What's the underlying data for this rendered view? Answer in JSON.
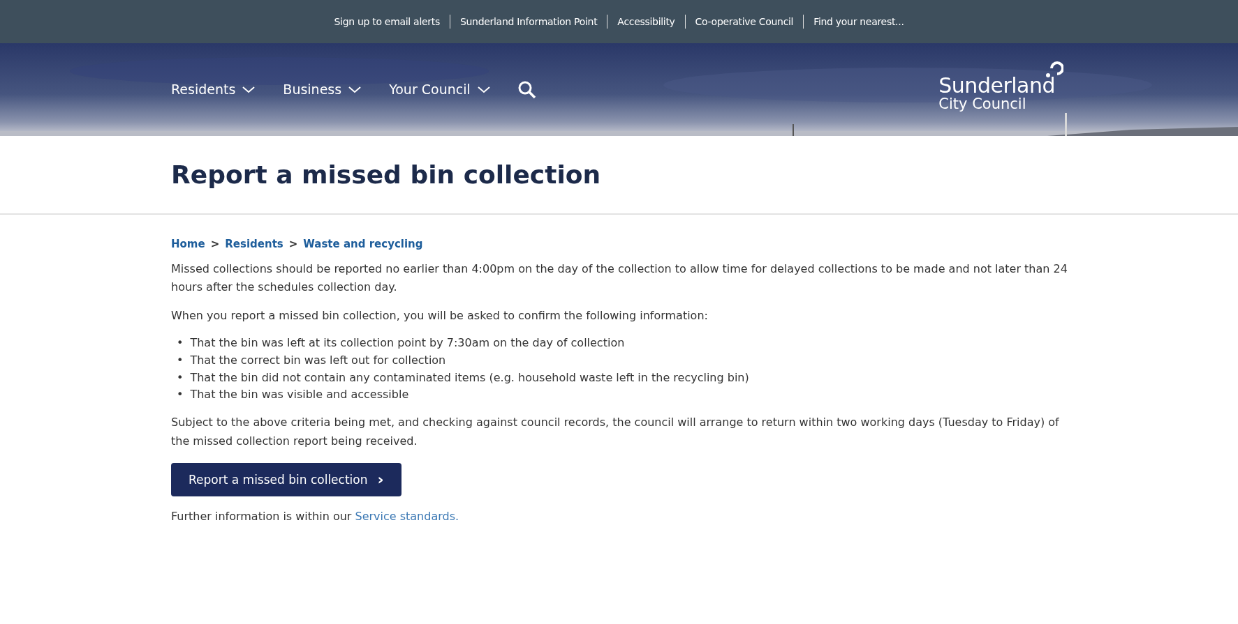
{
  "utility_links": [
    "Sign up to email alerts",
    "Sunderland Information Point",
    "Accessibility",
    "Co-operative Council",
    "Find your nearest..."
  ],
  "nav": {
    "items": [
      {
        "label": "Residents",
        "kind": "dropdown"
      },
      {
        "label": "Business",
        "kind": "dropdown"
      },
      {
        "label": "Your Council",
        "kind": "dropdown"
      },
      {
        "kind": "search"
      }
    ],
    "logo": {
      "line_1": "Sunderland",
      "line_2": "City Council"
    }
  },
  "page_title": "Report a missed bin collection",
  "breadcrumbs": [
    "Home",
    "Residents",
    "Waste and recycling"
  ],
  "breadcrumb_separator": ">",
  "paragraphs_before": [
    "Missed collections should be reported no earlier than 4:00pm on the day of the collection to allow time for delayed collections to be made and not later than 24 hours after the schedules collection day.",
    "When you report a missed bin collection, you will be asked to confirm the following information:"
  ],
  "criteria_marker": "•",
  "criteria": [
    "That the bin was left at its collection point by 7:30am on the day of collection",
    "That the correct bin was left out for collection",
    "That the bin did not contain any contaminated items (e.g. household waste left in the recycling bin)",
    "That the bin was visible and accessible"
  ],
  "paragraphs_after": [
    "Subject to the above criteria being met, and checking against council records, the council will arrange to return within two working days (Tuesday to Friday) of the missed collection report being received."
  ],
  "action_button": {
    "label": "Report a missed bin collection",
    "glyph": "›"
  },
  "further_info": {
    "text": "Further information is within our ",
    "link": "Service standards."
  }
}
